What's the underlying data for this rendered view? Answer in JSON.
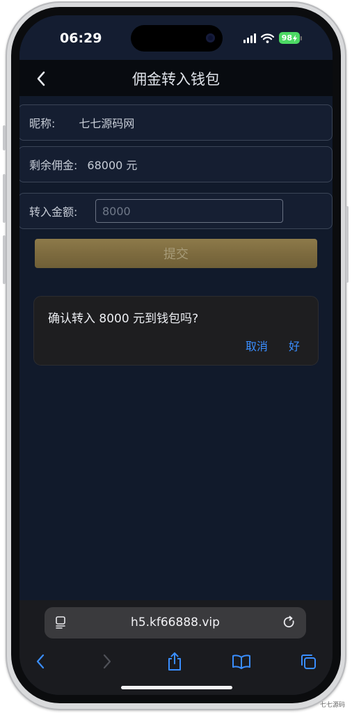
{
  "status_bar": {
    "time": "06:29",
    "battery": "98"
  },
  "nav": {
    "title": "佣金转入钱包"
  },
  "form": {
    "nickname_label": "昵称:",
    "nickname_value": "七七源码网",
    "remaining_label": "剩余佣金:",
    "remaining_value": "68000 元",
    "amount_label": "转入金额:",
    "amount_placeholder": "8000",
    "submit_label": "提交"
  },
  "dialog": {
    "message": "确认转入 8000 元到钱包吗?",
    "cancel_label": "取消",
    "ok_label": "好"
  },
  "browser": {
    "url": "h5.kf66888.vip"
  },
  "watermark": "七七源码",
  "colors": {
    "accent": "#3a8eff",
    "submit_gold": "#8d7a4a",
    "battery_green": "#4cd964",
    "page_bg": "#111a2b"
  }
}
